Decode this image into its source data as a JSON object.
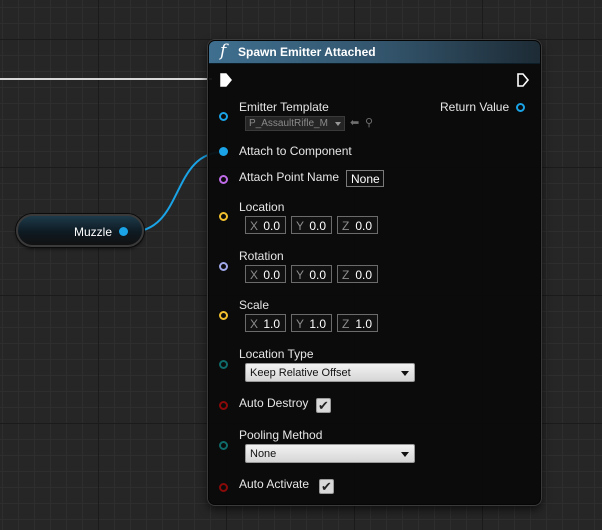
{
  "node": {
    "title": "Spawn Emitter Attached",
    "title_icon": "function-f-icon",
    "header_color": "#3f6f8f"
  },
  "variable_node": {
    "label": "Muzzle"
  },
  "pins": {
    "emitter_template": {
      "label": "Emitter Template",
      "asset_value": "P_AssaultRifle_M"
    },
    "return_value": {
      "label": "Return Value"
    },
    "attach_to_component": {
      "label": "Attach to Component"
    },
    "attach_point_name": {
      "label": "Attach Point Name",
      "value": "None"
    },
    "location": {
      "label": "Location",
      "x_axis": "X",
      "x": "0.0",
      "y_axis": "Y",
      "y": "0.0",
      "z_axis": "Z",
      "z": "0.0"
    },
    "rotation": {
      "label": "Rotation",
      "x_axis": "X",
      "x": "0.0",
      "y_axis": "Y",
      "y": "0.0",
      "z_axis": "Z",
      "z": "0.0"
    },
    "scale": {
      "label": "Scale",
      "x_axis": "X",
      "x": "1.0",
      "y_axis": "Y",
      "y": "1.0",
      "z_axis": "Z",
      "z": "1.0"
    },
    "location_type": {
      "label": "Location Type",
      "selected": "Keep Relative Offset"
    },
    "auto_destroy": {
      "label": "Auto Destroy",
      "checked": true,
      "mark": "✔"
    },
    "pooling_method": {
      "label": "Pooling Method",
      "selected": "None"
    },
    "auto_activate": {
      "label": "Auto Activate",
      "checked": true,
      "mark": "✔"
    }
  },
  "colors": {
    "object_pin": "#1aa3e6",
    "name_pin": "#c06be8",
    "vector_pin": "#f2c02e",
    "rotator_pin": "#a0a8e8",
    "enum_pin": "#0f6a6a",
    "bool_pin": "#8a0a0a",
    "exec_pin": "#ffffff"
  }
}
